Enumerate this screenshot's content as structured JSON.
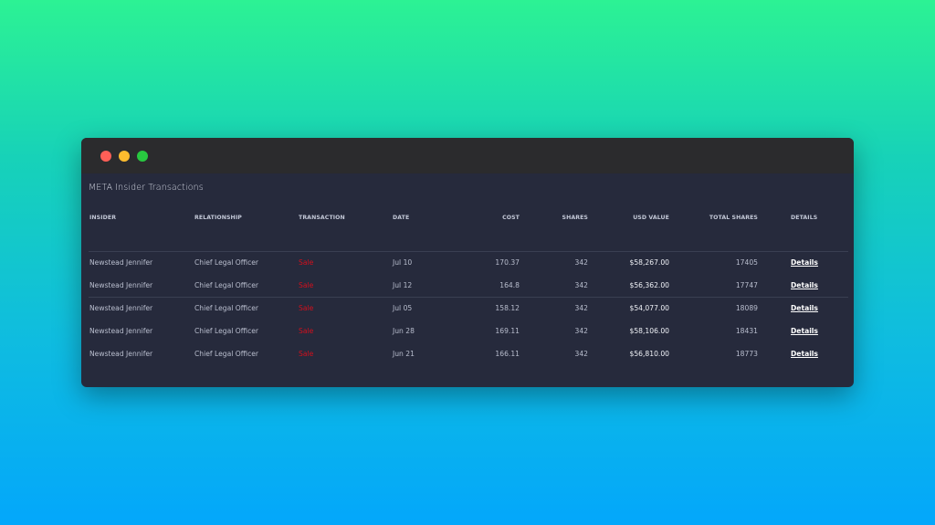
{
  "window": {
    "title": "META Insider Transactions"
  },
  "table": {
    "headers": {
      "insider": "INSIDER",
      "relationship": "RELATIONSHIP",
      "transaction": "TRANSACTION",
      "date": "DATE",
      "cost": "COST",
      "shares": "SHARES",
      "usd_value": "USD VALUE",
      "total_shares": "TOTAL SHARES",
      "details": "DETAILS"
    },
    "rows": [
      {
        "insider": "Newstead Jennifer",
        "relationship": "Chief Legal Officer",
        "transaction": "Sale",
        "date": "Jul 10",
        "cost": "170.37",
        "shares": "342",
        "usd_value": "$58,267.00",
        "total_shares": "17405",
        "details": "Details"
      },
      {
        "insider": "Newstead Jennifer",
        "relationship": "Chief Legal Officer",
        "transaction": "Sale",
        "date": "Jul 12",
        "cost": "164.8",
        "shares": "342",
        "usd_value": "$56,362.00",
        "total_shares": "17747",
        "details": "Details"
      },
      {
        "insider": "Newstead Jennifer",
        "relationship": "Chief Legal Officer",
        "transaction": "Sale",
        "date": "Jul 05",
        "cost": "158.12",
        "shares": "342",
        "usd_value": "$54,077.00",
        "total_shares": "18089",
        "details": "Details"
      },
      {
        "insider": "Newstead Jennifer",
        "relationship": "Chief Legal Officer",
        "transaction": "Sale",
        "date": "Jun 28",
        "cost": "169.11",
        "shares": "342",
        "usd_value": "$58,106.00",
        "total_shares": "18431",
        "details": "Details"
      },
      {
        "insider": "Newstead Jennifer",
        "relationship": "Chief Legal Officer",
        "transaction": "Sale",
        "date": "Jun 21",
        "cost": "166.11",
        "shares": "342",
        "usd_value": "$56,810.00",
        "total_shares": "18773",
        "details": "Details"
      }
    ]
  },
  "colors": {
    "sale": "#d40f1c",
    "window_bg": "#262a3c",
    "titlebar_bg": "#2b2b2d",
    "close": "#ff5f57",
    "minimize": "#febc2e",
    "maximize": "#28c840"
  }
}
